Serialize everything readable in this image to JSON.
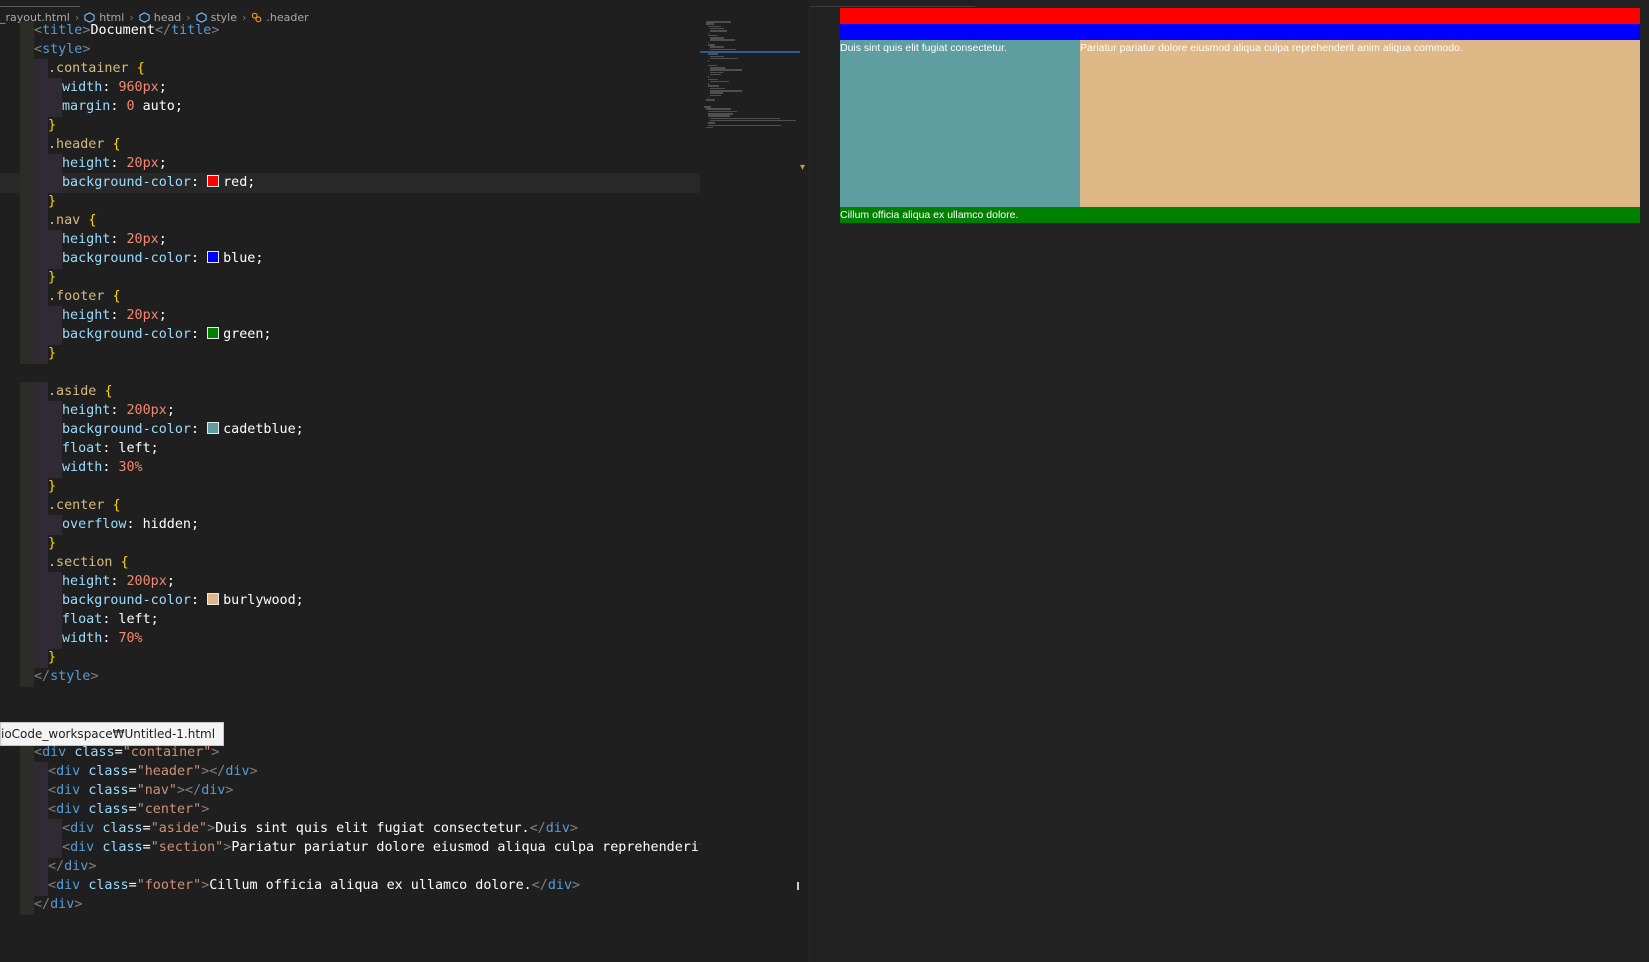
{
  "breadcrumb": {
    "file": "_rayout.html",
    "items": [
      "html",
      "head",
      "style",
      ".header"
    ]
  },
  "editor": {
    "lines": [
      [
        [
          "t-ang",
          "<"
        ],
        [
          "t-tag",
          "title"
        ],
        [
          "t-ang",
          ">"
        ],
        [
          "t-text",
          "Document"
        ],
        [
          "t-ang",
          "</"
        ],
        [
          "t-tag",
          "title"
        ],
        [
          "t-ang",
          ">"
        ]
      ],
      [
        [
          "t-ang",
          "<"
        ],
        [
          "t-tag",
          "style"
        ],
        [
          "t-ang",
          ">"
        ]
      ],
      [
        [
          "t-sel",
          ".container"
        ],
        [
          "t-kw",
          " "
        ],
        [
          "t-br",
          "{"
        ]
      ],
      [
        [
          "t-prop",
          "width"
        ],
        [
          "t-kw",
          ": "
        ],
        [
          "t-num",
          "960px"
        ],
        [
          "t-kw",
          ";"
        ]
      ],
      [
        [
          "t-prop",
          "margin"
        ],
        [
          "t-kw",
          ": "
        ],
        [
          "t-num",
          "0"
        ],
        [
          "t-kw",
          " auto;"
        ]
      ],
      [
        [
          "t-br",
          "}"
        ]
      ],
      [
        [
          "t-sel",
          ".header"
        ],
        [
          "t-kw",
          " "
        ],
        [
          "t-br",
          "{"
        ]
      ],
      [
        [
          "t-prop",
          "height"
        ],
        [
          "t-kw",
          ": "
        ],
        [
          "t-num",
          "20px"
        ],
        [
          "t-kw",
          ";"
        ]
      ],
      [
        [
          "t-prop",
          "background-color"
        ],
        [
          "t-kw",
          ": "
        ],
        [
          "swatch",
          "#ff0000"
        ],
        [
          "t-kw",
          "red;"
        ]
      ],
      [
        [
          "t-br",
          "}"
        ]
      ],
      [
        [
          "t-sel",
          ".nav"
        ],
        [
          "t-kw",
          " "
        ],
        [
          "t-br",
          "{"
        ]
      ],
      [
        [
          "t-prop",
          "height"
        ],
        [
          "t-kw",
          ": "
        ],
        [
          "t-num",
          "20px"
        ],
        [
          "t-kw",
          ";"
        ]
      ],
      [
        [
          "t-prop",
          "background-color"
        ],
        [
          "t-kw",
          ": "
        ],
        [
          "swatch",
          "#0000ff"
        ],
        [
          "t-kw",
          "blue;"
        ]
      ],
      [
        [
          "t-br",
          "}"
        ]
      ],
      [
        [
          "t-sel",
          ".footer"
        ],
        [
          "t-kw",
          " "
        ],
        [
          "t-br",
          "{"
        ]
      ],
      [
        [
          "t-prop",
          "height"
        ],
        [
          "t-kw",
          ": "
        ],
        [
          "t-num",
          "20px"
        ],
        [
          "t-kw",
          ";"
        ]
      ],
      [
        [
          "t-prop",
          "background-color"
        ],
        [
          "t-kw",
          ": "
        ],
        [
          "swatch",
          "#008000"
        ],
        [
          "t-kw",
          "green;"
        ]
      ],
      [
        [
          "t-br",
          "}"
        ]
      ],
      [],
      [
        [
          "t-sel",
          ".aside"
        ],
        [
          "t-kw",
          " "
        ],
        [
          "t-br",
          "{"
        ]
      ],
      [
        [
          "t-prop",
          "height"
        ],
        [
          "t-kw",
          ": "
        ],
        [
          "t-num",
          "200px"
        ],
        [
          "t-kw",
          ";"
        ]
      ],
      [
        [
          "t-prop",
          "background-color"
        ],
        [
          "t-kw",
          ": "
        ],
        [
          "swatch",
          "#5f9ea0"
        ],
        [
          "t-kw",
          "cadetblue;"
        ]
      ],
      [
        [
          "t-prop",
          "float"
        ],
        [
          "t-kw",
          ": left;"
        ]
      ],
      [
        [
          "t-prop",
          "width"
        ],
        [
          "t-kw",
          ": "
        ],
        [
          "t-num",
          "30%"
        ]
      ],
      [
        [
          "t-br",
          "}"
        ]
      ],
      [
        [
          "t-sel",
          ".center"
        ],
        [
          "t-kw",
          " "
        ],
        [
          "t-br",
          "{"
        ]
      ],
      [
        [
          "t-prop",
          "overflow"
        ],
        [
          "t-kw",
          ": hidden;"
        ]
      ],
      [
        [
          "t-br",
          "}"
        ]
      ],
      [
        [
          "t-sel",
          ".section"
        ],
        [
          "t-kw",
          " "
        ],
        [
          "t-br",
          "{"
        ]
      ],
      [
        [
          "t-prop",
          "height"
        ],
        [
          "t-kw",
          ": "
        ],
        [
          "t-num",
          "200px"
        ],
        [
          "t-kw",
          ";"
        ]
      ],
      [
        [
          "t-prop",
          "background-color"
        ],
        [
          "t-kw",
          ": "
        ],
        [
          "swatch",
          "#deb887"
        ],
        [
          "t-kw",
          "burlywood;"
        ]
      ],
      [
        [
          "t-prop",
          "float"
        ],
        [
          "t-kw",
          ": left;"
        ]
      ],
      [
        [
          "t-prop",
          "width"
        ],
        [
          "t-kw",
          ": "
        ],
        [
          "t-num",
          "70%"
        ]
      ],
      [
        [
          "t-br",
          "}"
        ]
      ],
      [
        [
          "t-ang",
          "</"
        ],
        [
          "t-tag",
          "style"
        ],
        [
          "t-ang",
          ">"
        ]
      ],
      [],
      [],
      [
        [
          "t-ang",
          "<"
        ],
        [
          "t-tag",
          "body"
        ],
        [
          "t-ang",
          ">"
        ]
      ],
      [
        [
          "t-ang",
          "<"
        ],
        [
          "t-tag",
          "div"
        ],
        [
          "t-kw",
          " "
        ],
        [
          "t-attr",
          "class"
        ],
        [
          "t-kw",
          "="
        ],
        [
          "t-str",
          "\"container\""
        ],
        [
          "t-ang",
          ">"
        ]
      ],
      [
        [
          "t-ang",
          "<"
        ],
        [
          "t-tag",
          "div"
        ],
        [
          "t-kw",
          " "
        ],
        [
          "t-attr",
          "class"
        ],
        [
          "t-kw",
          "="
        ],
        [
          "t-str",
          "\"header\""
        ],
        [
          "t-ang",
          "></"
        ],
        [
          "t-tag",
          "div"
        ],
        [
          "t-ang",
          ">"
        ]
      ],
      [
        [
          "t-ang",
          "<"
        ],
        [
          "t-tag",
          "div"
        ],
        [
          "t-kw",
          " "
        ],
        [
          "t-attr",
          "class"
        ],
        [
          "t-kw",
          "="
        ],
        [
          "t-str",
          "\"nav\""
        ],
        [
          "t-ang",
          "></"
        ],
        [
          "t-tag",
          "div"
        ],
        [
          "t-ang",
          ">"
        ]
      ],
      [
        [
          "t-ang",
          "<"
        ],
        [
          "t-tag",
          "div"
        ],
        [
          "t-kw",
          " "
        ],
        [
          "t-attr",
          "class"
        ],
        [
          "t-kw",
          "="
        ],
        [
          "t-str",
          "\"center\""
        ],
        [
          "t-ang",
          ">"
        ]
      ],
      [
        [
          "t-ang",
          "<"
        ],
        [
          "t-tag",
          "div"
        ],
        [
          "t-kw",
          " "
        ],
        [
          "t-attr",
          "class"
        ],
        [
          "t-kw",
          "="
        ],
        [
          "t-str",
          "\"aside\""
        ],
        [
          "t-ang",
          ">"
        ],
        [
          "t-text",
          "Duis sint quis elit fugiat consectetur."
        ],
        [
          "t-ang",
          "</"
        ],
        [
          "t-tag",
          "div"
        ],
        [
          "t-ang",
          ">"
        ]
      ],
      [
        [
          "t-ang",
          "<"
        ],
        [
          "t-tag",
          "div"
        ],
        [
          "t-kw",
          " "
        ],
        [
          "t-attr",
          "class"
        ],
        [
          "t-kw",
          "="
        ],
        [
          "t-str",
          "\"section\""
        ],
        [
          "t-ang",
          ">"
        ],
        [
          "t-text",
          "Pariatur pariatur dolore eiusmod aliqua culpa reprehenderit anim"
        ]
      ],
      [
        [
          "t-ang",
          "</"
        ],
        [
          "t-tag",
          "div"
        ],
        [
          "t-ang",
          ">"
        ]
      ],
      [
        [
          "t-ang",
          "<"
        ],
        [
          "t-tag",
          "div"
        ],
        [
          "t-kw",
          " "
        ],
        [
          "t-attr",
          "class"
        ],
        [
          "t-kw",
          "="
        ],
        [
          "t-str",
          "\"footer\""
        ],
        [
          "t-ang",
          ">"
        ],
        [
          "t-text",
          "Cillum officia aliqua ex ullamco dolore."
        ],
        [
          "t-ang",
          "</"
        ],
        [
          "t-tag",
          "div"
        ],
        [
          "t-ang",
          ">"
        ]
      ],
      [
        [
          "t-ang",
          "</"
        ],
        [
          "t-tag",
          "div"
        ],
        [
          "t-ang",
          ">"
        ]
      ]
    ]
  },
  "tooltip": "ioCode_workspace₩Untitled-1.html",
  "preview": {
    "aside_text": "Duis sint quis elit fugiat consectetur.",
    "section_text": "Pariatur pariatur dolore eiusmod aliqua culpa reprehenderit anim aliqua commodo.",
    "footer_text": "Cillum officia aliqua ex ullamco dolore."
  }
}
